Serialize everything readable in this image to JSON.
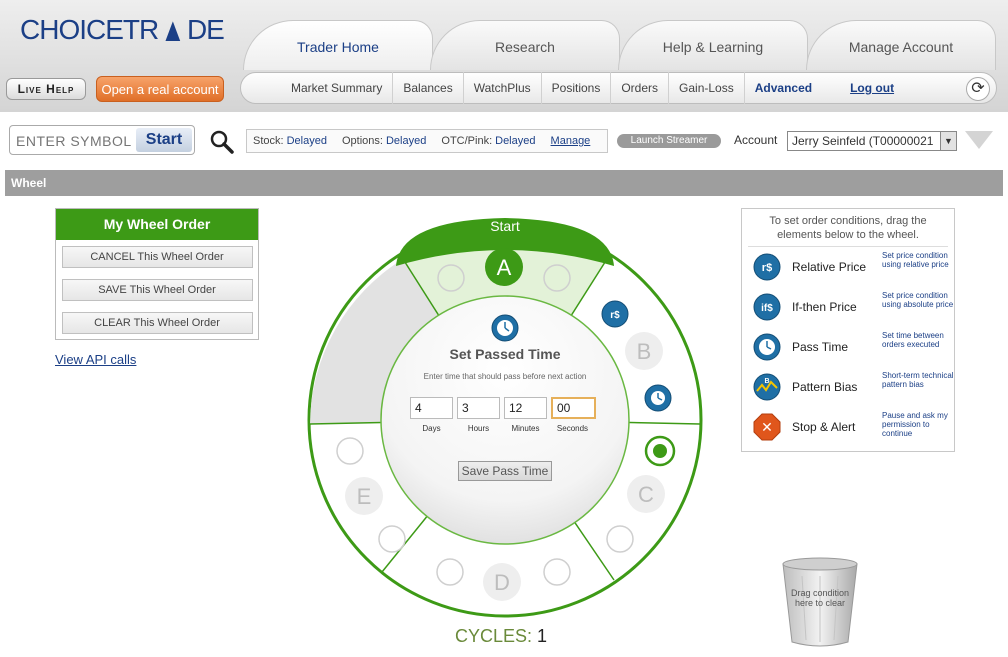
{
  "brand": {
    "logo_text_a": "CHOICETR",
    "logo_text_b": "DE"
  },
  "main_tabs": [
    {
      "label": "Trader Home",
      "active": true
    },
    {
      "label": "Research",
      "active": false
    },
    {
      "label": "Help & Learning",
      "active": false
    },
    {
      "label": "Manage Account",
      "active": false
    }
  ],
  "header": {
    "live_help": "Live Help",
    "open_account": "Open a real account"
  },
  "subnav": {
    "items": [
      "Market Summary",
      "Balances",
      "WatchPlus",
      "Positions",
      "Orders",
      "Gain-Loss",
      "Advanced"
    ],
    "logout": "Log out",
    "refresh_icon": "refresh-icon"
  },
  "toolbar": {
    "symbol_placeholder": "ENTER SYMBOL",
    "start": "Start",
    "stock_label": "Stock:",
    "stock_val": "Delayed",
    "options_label": "Options:",
    "options_val": "Delayed",
    "otc_label": "OTC/Pink:",
    "otc_val": "Delayed",
    "manage": "Manage",
    "launch": "Launch Streamer",
    "account_label": "Account",
    "account_value": "Jerry Seinfeld (T00000021"
  },
  "section": {
    "title": "Wheel"
  },
  "order_panel": {
    "title": "My Wheel Order",
    "cancel": "CANCEL This Wheel Order",
    "save": "SAVE This Wheel Order",
    "clear": "CLEAR This Wheel Order",
    "api_link": "View API calls"
  },
  "wheel": {
    "start": "Start",
    "segments": [
      "A",
      "B",
      "C",
      "D",
      "E"
    ],
    "center_title": "Set Passed Time",
    "center_sub": "Enter time that should pass before next action",
    "days": "4",
    "hours": "3",
    "minutes": "12",
    "seconds": "00",
    "days_lbl": "Days",
    "hours_lbl": "Hours",
    "minutes_lbl": "Minutes",
    "seconds_lbl": "Seconds",
    "save_btn": "Save Pass Time",
    "cycles_label": "CYCLES:",
    "cycles_value": "1",
    "active_color": "#3d9a16"
  },
  "conditions": {
    "header": "To set order conditions, drag the elements below to the wheel.",
    "items": [
      {
        "name": "Relative Price",
        "desc": "Set price condition using relative price",
        "icon": "relative-price-icon",
        "glyph": "r$"
      },
      {
        "name": "If-then Price",
        "desc": "Set price condition using absolute price",
        "icon": "if-then-price-icon",
        "glyph": "if$"
      },
      {
        "name": "Pass Time",
        "desc": "Set time between orders executed",
        "icon": "clock-icon",
        "glyph": ""
      },
      {
        "name": "Pattern Bias",
        "desc": "Short-term technical pattern bias",
        "icon": "pattern-bias-icon",
        "glyph": "B"
      },
      {
        "name": "Stop & Alert",
        "desc": "Pause and ask my permission to continue",
        "icon": "stop-alert-icon",
        "glyph": "✕"
      }
    ]
  },
  "trash": {
    "text": "Drag condition here to clear"
  }
}
